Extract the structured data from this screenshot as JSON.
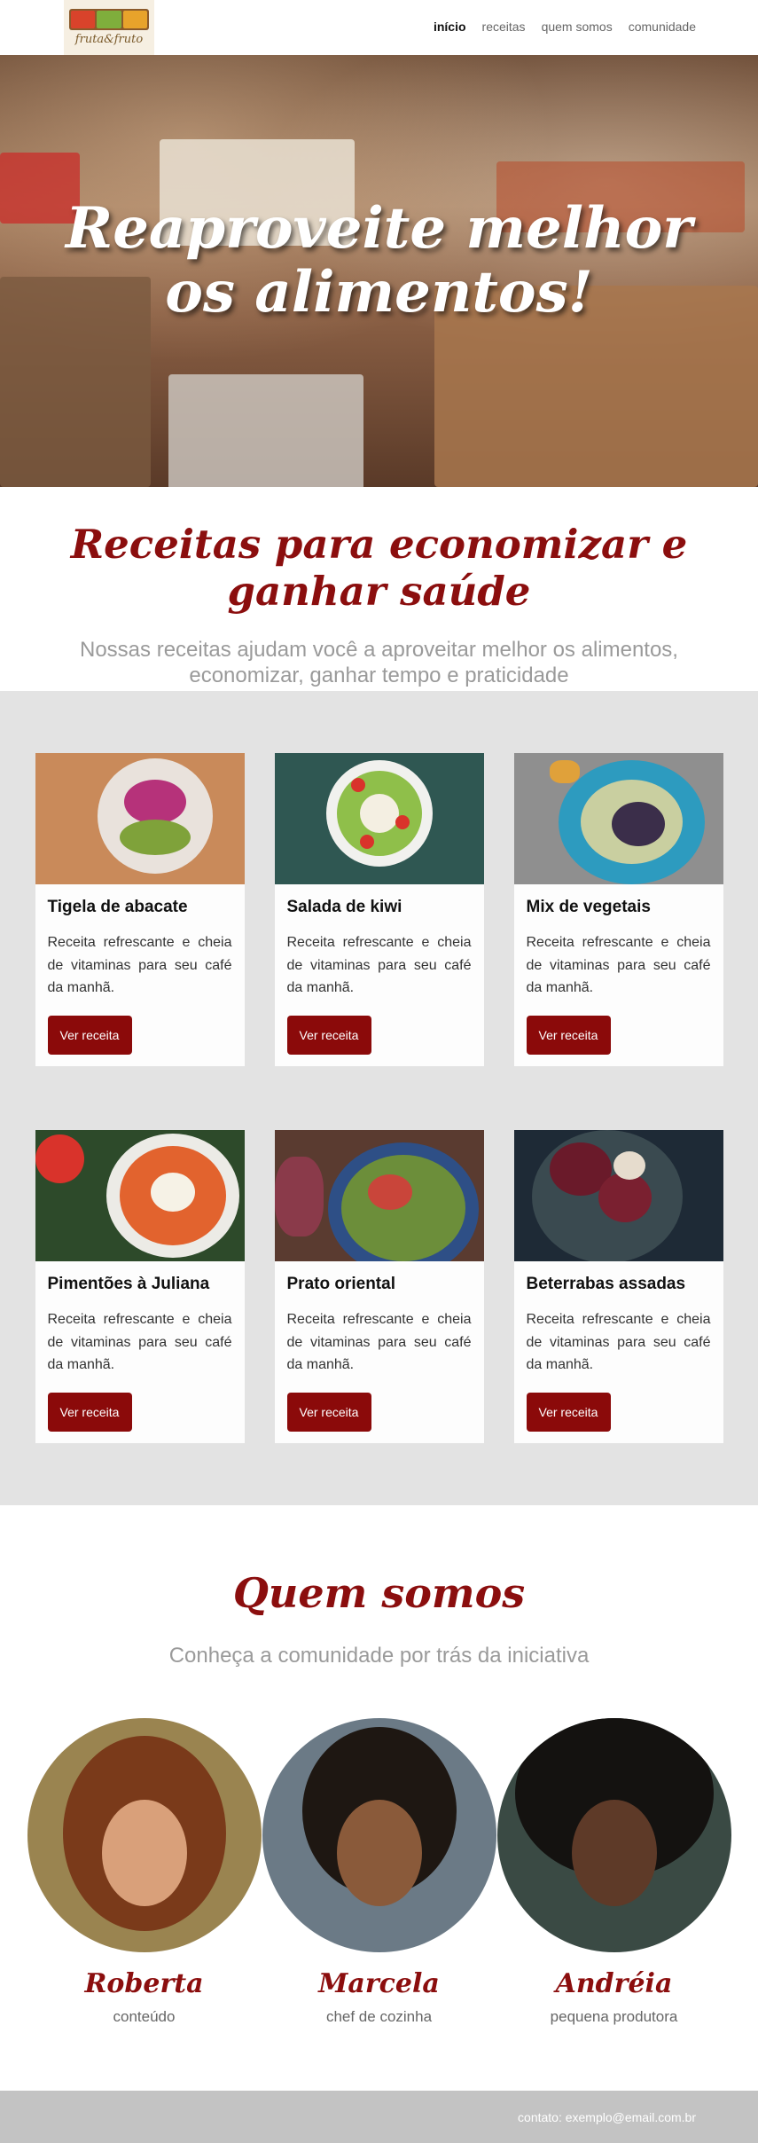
{
  "brand": {
    "logo_text": "fruta&fruto"
  },
  "nav": {
    "items": [
      {
        "label": "início",
        "active": true
      },
      {
        "label": "receitas",
        "active": false
      },
      {
        "label": "quem somos",
        "active": false
      },
      {
        "label": "comunidade",
        "active": false
      }
    ]
  },
  "hero": {
    "title": "Reaproveite melhor os alimentos!"
  },
  "recipes_intro": {
    "title": "Receitas para economizar e ganhar saúde",
    "subtitle": "Nossas receitas ajudam você a aproveitar melhor os alimentos, economizar, ganhar tempo e praticidade"
  },
  "recipes": [
    {
      "title": "Tigela de abacate",
      "description": "Receita refrescante e cheia de vitaminas para seu café da manhã.",
      "button": "Ver receita",
      "image_icon": "avocado-bowl-photo",
      "bg": "#c98a5a",
      "accent": "#8a3a6a"
    },
    {
      "title": "Salada de kiwi",
      "description": "Receita refrescante e cheia de vitaminas para seu café da manhã.",
      "button": "Ver receita",
      "image_icon": "kiwi-salad-photo",
      "bg": "#2f5752",
      "accent": "#7fae3c"
    },
    {
      "title": "Mix de vegetais",
      "description": "Receita refrescante e cheia de vitaminas para seu café da manhã.",
      "button": "Ver receita",
      "image_icon": "vegetable-mix-photo",
      "bg": "#8f8f8f",
      "accent": "#2d9bbf"
    },
    {
      "title": "Pimentões à Juliana",
      "description": "Receita refrescante e cheia de vitaminas para seu café da manhã.",
      "button": "Ver receita",
      "image_icon": "peppers-julienne-photo",
      "bg": "#2d4a2a",
      "accent": "#d9432b"
    },
    {
      "title": "Prato oriental",
      "description": "Receita refrescante e cheia de vitaminas para seu café da manhã.",
      "button": "Ver receita",
      "image_icon": "oriental-dish-photo",
      "bg": "#5a3b30",
      "accent": "#3b6aa8"
    },
    {
      "title": "Beterrabas assadas",
      "description": "Receita refrescante e cheia de vitaminas para seu café da manhã.",
      "button": "Ver receita",
      "image_icon": "roasted-beets-photo",
      "bg": "#1e2a36",
      "accent": "#6a1a2a"
    }
  ],
  "about": {
    "title": "Quem somos",
    "subtitle": "Conheça a comunidade por trás da iniciativa",
    "people": [
      {
        "name": "Roberta",
        "role": "conteúdo",
        "bg": "#9a8450",
        "hair": "#7a3a1a",
        "skin": "#d9a07a"
      },
      {
        "name": "Marcela",
        "role": "chef de cozinha",
        "bg": "#6b7a86",
        "hair": "#1e1712",
        "skin": "#8a5a3a"
      },
      {
        "name": "Andréia",
        "role": "pequena produtora",
        "bg": "#3a4a44",
        "hair": "#141210",
        "skin": "#5e3a28"
      }
    ]
  },
  "footer": {
    "contact": "contato: exemplo@email.com.br"
  },
  "colors": {
    "brand_red": "#8b0e0e",
    "button_red": "#8b0a0a",
    "cards_bg": "#e3e3e3",
    "footer_bg": "#c3c3c3"
  }
}
